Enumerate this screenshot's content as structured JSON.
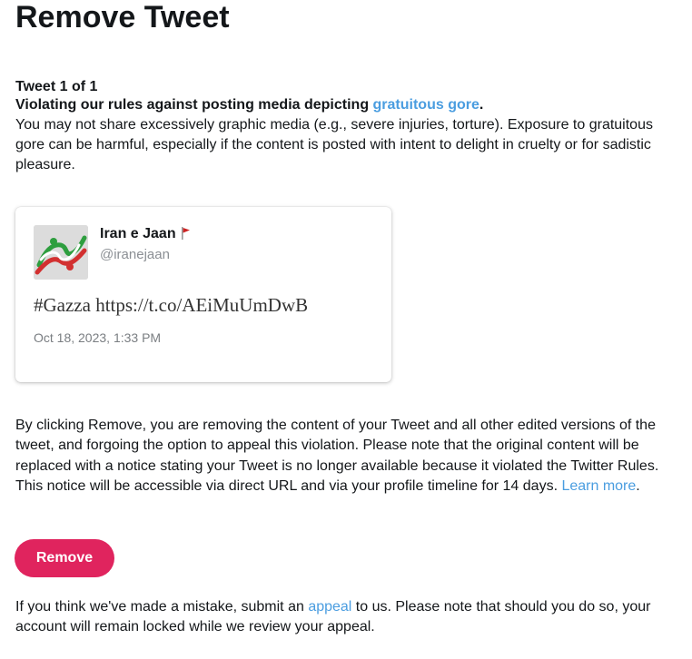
{
  "header": {
    "title": "Remove Tweet"
  },
  "violation": {
    "counter": "Tweet 1 of 1",
    "rule_prefix": "Violating our rules against posting media depicting ",
    "rule_link": "gratuitous gore",
    "rule_suffix": ".",
    "description": "You may not share excessively graphic media (e.g., severe injuries, torture). Exposure to gratuitous gore can be harmful, especially if the content is posted with intent to delight in cruelty or for sadistic pleasure."
  },
  "tweet": {
    "display_name": "Iran e Jaan",
    "handle": "@iranejaan",
    "text": "#Gazza https://t.co/AEiMuUmDwB",
    "timestamp": "Oct 18, 2023, 1:33 PM",
    "avatar_icon": "avatar-image",
    "flag_icon": "red-flag-icon"
  },
  "notice": {
    "text": "By clicking Remove, you are removing the content of your Tweet and all other edited versions of the tweet, and forgoing the option to appeal this violation. Please note that the original content will be replaced with a notice stating your Tweet is no longer available because it violated the Twitter Rules. This notice will be accessible via direct URL and via your profile timeline for 14 days. ",
    "link": "Learn more",
    "suffix": "."
  },
  "actions": {
    "remove_label": "Remove"
  },
  "appeal": {
    "prefix": "If you think we've made a mistake, submit an ",
    "link": "appeal",
    "suffix": " to us. Please note that should you do so, your account will remain locked while we review your appeal."
  },
  "colors": {
    "link": "#4a9de0",
    "remove_button": "#e0245e",
    "text": "#14171a",
    "muted": "#8b8f94"
  }
}
